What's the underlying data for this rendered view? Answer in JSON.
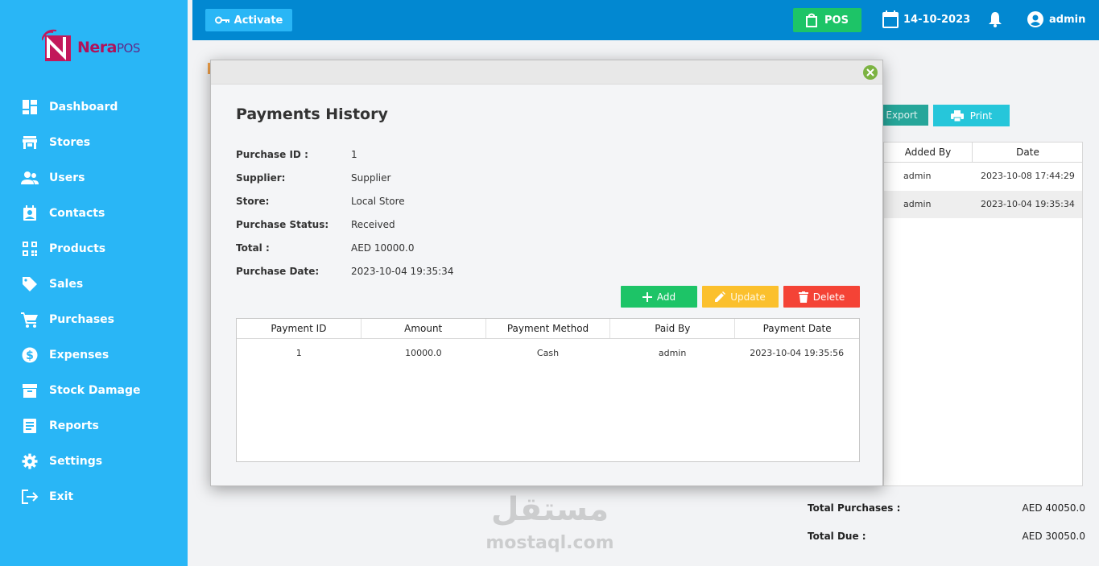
{
  "brand": {
    "name_part1": "Nera",
    "name_part2": "POS",
    "colors": {
      "sidebar": "#29b6f6",
      "topbar": "#0288d1",
      "pos_button": "#1dc467"
    }
  },
  "sidebar": {
    "items": [
      {
        "label": "Dashboard",
        "icon": "dashboard-icon"
      },
      {
        "label": "Stores",
        "icon": "store-icon"
      },
      {
        "label": "Users",
        "icon": "users-icon"
      },
      {
        "label": "Contacts",
        "icon": "contacts-icon"
      },
      {
        "label": "Products",
        "icon": "qr-code-icon"
      },
      {
        "label": "Sales",
        "icon": "tag-icon"
      },
      {
        "label": "Purchases",
        "icon": "cart-icon"
      },
      {
        "label": "Expenses",
        "icon": "dollar-icon"
      },
      {
        "label": "Stock Damage",
        "icon": "archive-icon"
      },
      {
        "label": "Reports",
        "icon": "report-icon"
      },
      {
        "label": "Settings",
        "icon": "gear-icon"
      },
      {
        "label": "Exit",
        "icon": "exit-icon"
      }
    ]
  },
  "topbar": {
    "activate_label": "Activate",
    "pos_label": "POS",
    "date": "14-10-2023",
    "user": "admin"
  },
  "background": {
    "export_label": "Export",
    "print_label": "Print",
    "table": {
      "headers": [
        "Added By",
        "Date"
      ],
      "rows": [
        {
          "added_by": "admin",
          "date": "2023-10-08 17:44:29"
        },
        {
          "added_by": "admin",
          "date": "2023-10-04 19:35:34"
        }
      ]
    },
    "totals": {
      "purchases_label": "Total Purchases :",
      "purchases_value": "AED  40050.0",
      "due_label": "Total Due :",
      "due_value": "AED  30050.0"
    }
  },
  "modal": {
    "title": "Payments History",
    "info": [
      {
        "key": "Purchase ID :",
        "value": "1"
      },
      {
        "key": "Supplier:",
        "value": "Supplier"
      },
      {
        "key": "Store:",
        "value": "Local Store"
      },
      {
        "key": "Purchase Status:",
        "value": "Received"
      },
      {
        "key": "Total :",
        "value": "AED  10000.0"
      },
      {
        "key": "Purchase Date:",
        "value": "2023-10-04 19:35:34"
      }
    ],
    "buttons": {
      "add": "Add",
      "update": "Update",
      "delete": "Delete"
    },
    "table": {
      "headers": [
        "Payment ID",
        "Amount",
        "Payment Method",
        "Paid By",
        "Payment Date"
      ],
      "rows": [
        [
          "1",
          "10000.0",
          "Cash",
          "admin",
          "2023-10-04 19:35:56"
        ]
      ]
    }
  },
  "watermark": {
    "arabic": "مستقل",
    "latin": "mostaql.com"
  }
}
